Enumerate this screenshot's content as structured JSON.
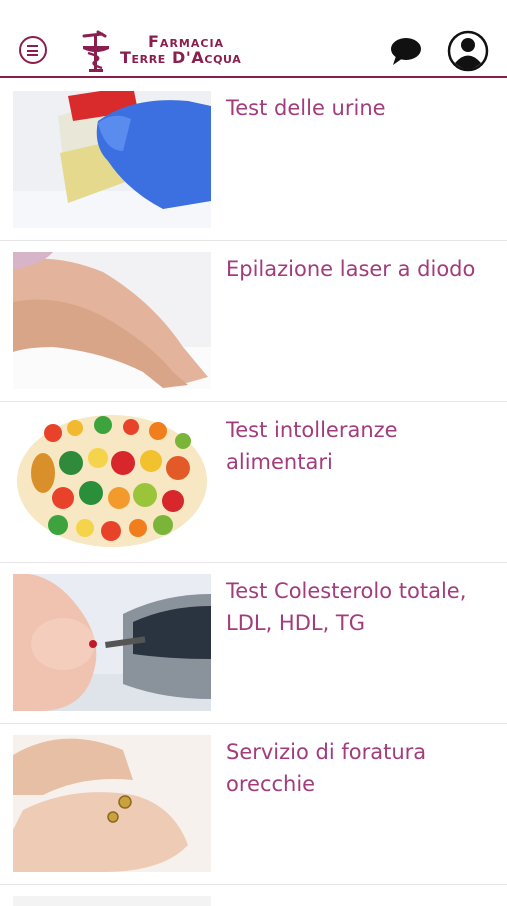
{
  "header": {
    "logo_line1": "Farmacia",
    "logo_line2": "Terre D'Acqua",
    "menu_icon": "hamburger-circle-icon",
    "chat_icon": "chat-bubble-icon",
    "profile_icon": "user-profile-icon",
    "brand_color": "#8a1f4f"
  },
  "services": [
    {
      "title": "Test delle urine",
      "image": "urine-sample-image"
    },
    {
      "title": "Epilazione laser a diodo",
      "image": "legs-image"
    },
    {
      "title": "Test intolleranze alimentari",
      "image": "fruits-vegetables-image"
    },
    {
      "title": "Test Colesterolo totale, LDL, HDL, TG",
      "image": "glucometer-finger-image"
    },
    {
      "title": "Servizio di foratura orecchie",
      "image": "earrings-hands-image"
    }
  ],
  "colors": {
    "title_text": "#a23c7c",
    "divider": "#e6e6e6"
  }
}
